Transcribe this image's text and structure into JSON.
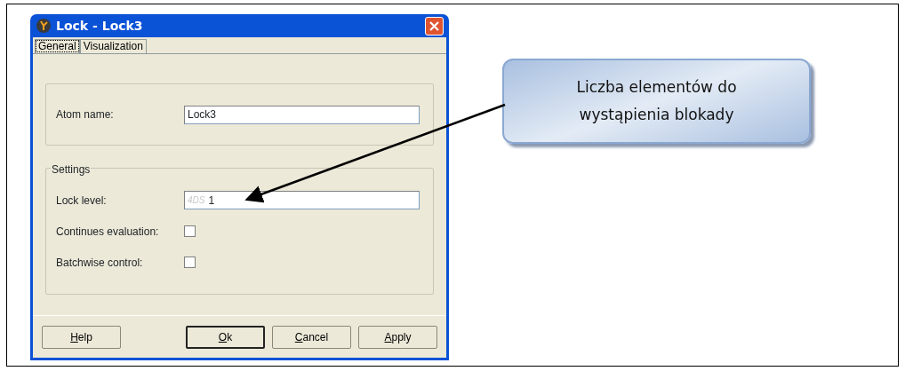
{
  "window": {
    "title": "Lock - Lock3"
  },
  "tabs": [
    {
      "label": "General",
      "selected": true
    },
    {
      "label": "Visualization",
      "selected": false
    }
  ],
  "atom_group": {
    "fields": [
      {
        "kind": "text",
        "label": "Atom name:",
        "value": "Lock3"
      }
    ]
  },
  "settings_group": {
    "title": "Settings",
    "fields": [
      {
        "kind": "text",
        "label": "Lock level:",
        "prefix": "4DS",
        "value": "1"
      },
      {
        "kind": "checkbox",
        "label": "Continues evaluation:",
        "checked": false
      },
      {
        "kind": "checkbox",
        "label": "Batchwise control:",
        "checked": false
      }
    ]
  },
  "buttons": [
    {
      "mnemonic": "H",
      "rest": "elp",
      "default": false
    },
    {
      "mnemonic": "O",
      "rest": "k",
      "default": true
    },
    {
      "mnemonic": "C",
      "rest": "ancel",
      "default": false
    },
    {
      "mnemonic": "A",
      "rest": "pply",
      "default": false
    }
  ],
  "callout": {
    "text": "Liczba elementów do wystąpienia blokady"
  }
}
